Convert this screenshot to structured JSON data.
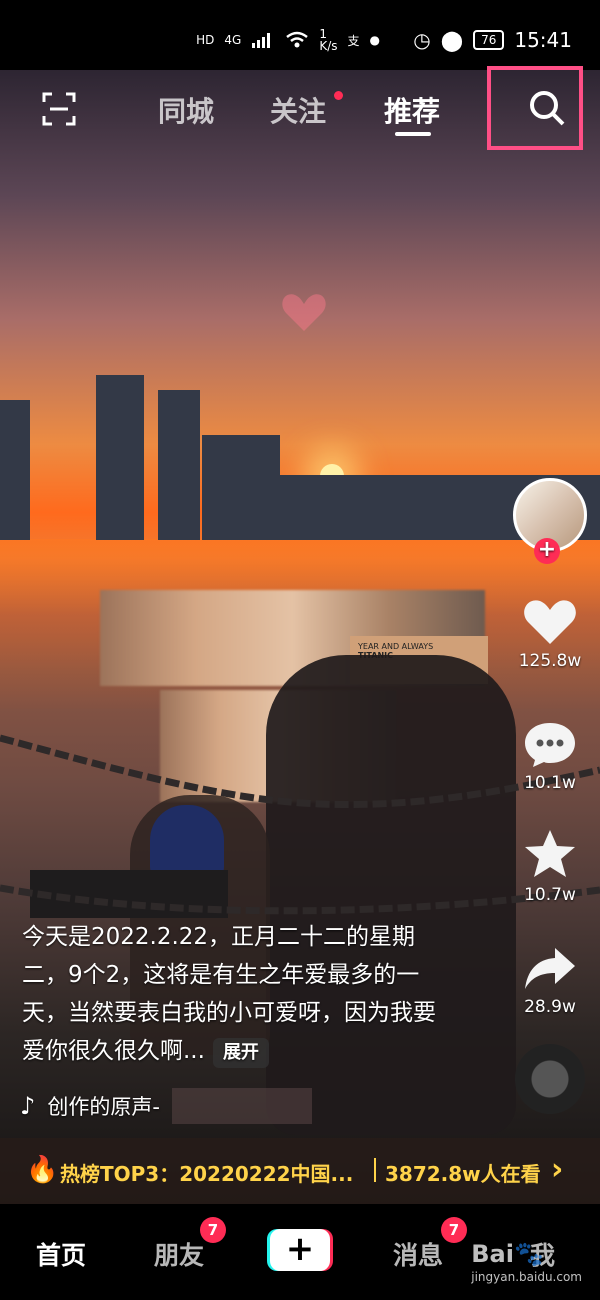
{
  "status_bar": {
    "hd": "HD",
    "signal": "4G",
    "speed_value": "1",
    "speed_unit": "K/s",
    "battery": "76",
    "time": "15:41"
  },
  "top_nav": {
    "items": [
      "同城",
      "关注",
      "推荐"
    ],
    "search_icon": "search-icon",
    "scan_icon": "scan-icon"
  },
  "video_overlay": {
    "poster_small_1": "YEAR AND ALWAYS",
    "poster_small_2": "TITANIC"
  },
  "right_rail": {
    "likes": "125.8w",
    "comments": "10.1w",
    "favorites": "10.7w",
    "shares": "28.9w"
  },
  "caption": {
    "text": "今天是2022.2.22，正月二十二的星期二，9个2，这将是有生之年爱最多的一天，当然要表白我的小可爱呀，因为我要爱你很久很久啊...",
    "expand": "展开"
  },
  "music": {
    "text": "创作的原声-"
  },
  "hot_bar": {
    "text": "热榜TOP3：20220222中国...",
    "viewers": "3872.8w人在看"
  },
  "bottom_nav": {
    "home": "首页",
    "friends": "朋友",
    "friends_badge": "7",
    "messages": "消息",
    "messages_badge": "7",
    "me": "我"
  },
  "watermark": {
    "brand": "Bai",
    "sub": "jingyan.baidu.com"
  }
}
